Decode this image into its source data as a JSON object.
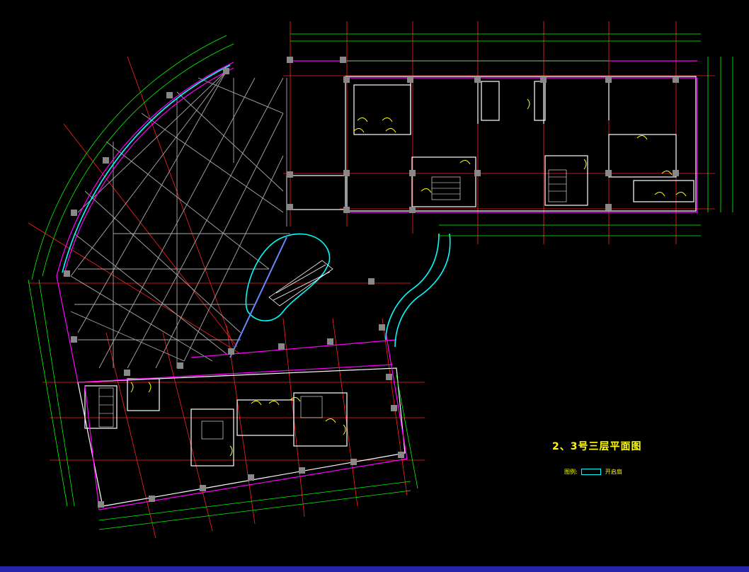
{
  "drawing": {
    "title": "2、3号三层平面图",
    "legend_prefix": "图例:",
    "legend_item": "开启扇"
  },
  "colors": {
    "background": "#000000",
    "axis_bubble": "#00ff00",
    "dimension": "#00ff00",
    "grid_line": "#ff2222",
    "wall": "#ffffff",
    "facade": "#ff00ff",
    "glass": "#00ffff",
    "door": "#ffff00",
    "title": "#ffff00",
    "frame_bar": "#2424a8"
  },
  "icons": [
    "axis-bubble-icon",
    "window-legend-icon"
  ]
}
